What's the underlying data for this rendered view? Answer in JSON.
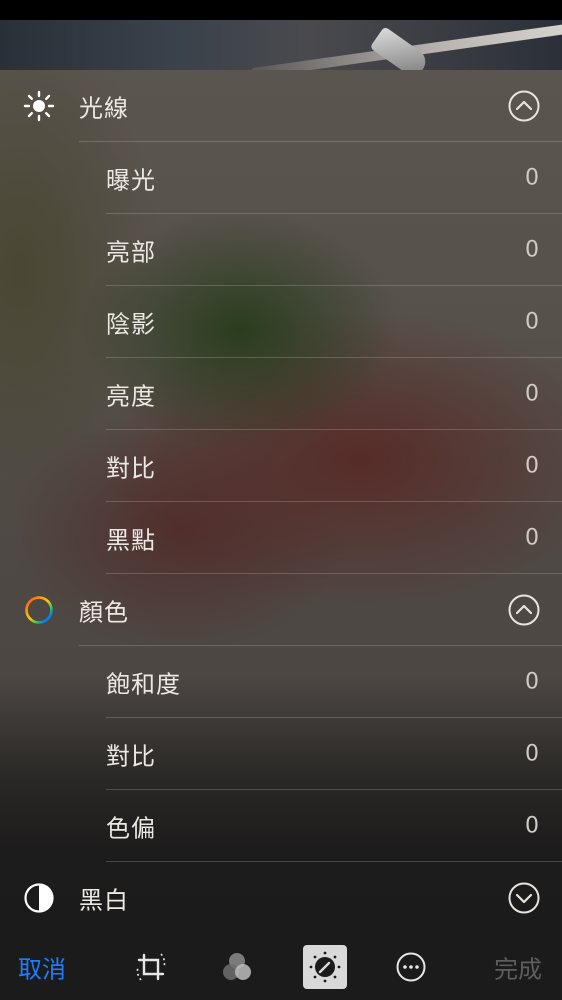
{
  "sections": {
    "light": {
      "label": "光線",
      "icon": "sun-icon",
      "expanded": true,
      "items": [
        {
          "label": "曝光",
          "value": "0"
        },
        {
          "label": "亮部",
          "value": "0"
        },
        {
          "label": "陰影",
          "value": "0"
        },
        {
          "label": "亮度",
          "value": "0"
        },
        {
          "label": "對比",
          "value": "0"
        },
        {
          "label": "黑點",
          "value": "0"
        }
      ]
    },
    "color": {
      "label": "顏色",
      "icon": "color-ring-icon",
      "expanded": true,
      "items": [
        {
          "label": "飽和度",
          "value": "0"
        },
        {
          "label": "對比",
          "value": "0"
        },
        {
          "label": "色偏",
          "value": "0"
        }
      ]
    },
    "bw": {
      "label": "黑白",
      "icon": "half-circle-icon",
      "expanded": false
    }
  },
  "toolbar": {
    "cancel_label": "取消",
    "done_label": "完成",
    "tools": [
      "crop-rotate-icon",
      "filters-icon",
      "adjust-dial-icon",
      "more-icon"
    ],
    "active_tool": "adjust-dial-icon"
  },
  "colors": {
    "accent": "#1f7cff",
    "toolbar_bg": "#1b1b1b",
    "done_disabled": "#5e5e5e"
  }
}
